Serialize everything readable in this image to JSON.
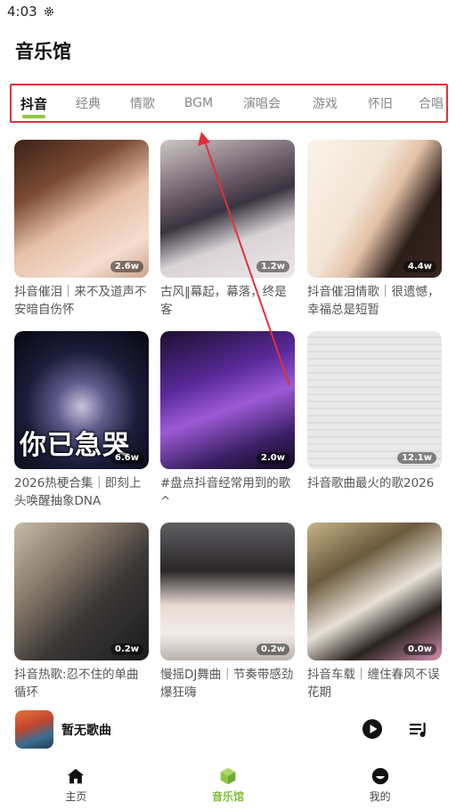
{
  "status_bar": {
    "time": "4:03",
    "icon": "gear-icon"
  },
  "page": {
    "title": "音乐馆"
  },
  "tabs": [
    {
      "label": "抖音",
      "active": true
    },
    {
      "label": "经典",
      "active": false
    },
    {
      "label": "情歌",
      "active": false
    },
    {
      "label": "BGM",
      "active": false
    },
    {
      "label": "演唱会",
      "active": false
    },
    {
      "label": "游戏",
      "active": false
    },
    {
      "label": "怀旧",
      "active": false
    },
    {
      "label": "合唱",
      "active": false
    }
  ],
  "playlists": [
    {
      "title": "抖音催泪｜来不及道声不安暗自伤怀",
      "count": "2.6w"
    },
    {
      "title": "古风‖幕起，幕落，终是客",
      "count": "1.2w"
    },
    {
      "title": "抖音催泪情歌｜很遗憾，幸福总是短暂",
      "count": "4.4w"
    },
    {
      "title": "2026热梗合集｜即刻上头唤醒抽象DNA",
      "count": "6.6w",
      "overlay": "你已急哭"
    },
    {
      "title": "#盘点抖音经常用到的歌^",
      "count": "2.0w"
    },
    {
      "title": "抖音歌曲最火的歌2026",
      "count": "12.1w"
    },
    {
      "title": "抖音热歌:忍不住的单曲循环",
      "count": "0.2w"
    },
    {
      "title": "慢摇DJ舞曲｜节奏带感劲爆狂嗨",
      "count": "0.2w"
    },
    {
      "title": "抖音车载｜缠住春风不误花期",
      "count": "0.0w"
    }
  ],
  "player": {
    "title": "暂无歌曲",
    "play_icon": "play-circle-icon",
    "queue_icon": "playlist-icon"
  },
  "nav": [
    {
      "label": "主页",
      "icon": "home-icon",
      "active": false
    },
    {
      "label": "音乐馆",
      "icon": "music-hall-icon",
      "active": true
    },
    {
      "label": "我的",
      "icon": "profile-icon",
      "active": false
    }
  ],
  "colors": {
    "accent": "#8cc63f",
    "highlight_box": "#e0303a"
  }
}
